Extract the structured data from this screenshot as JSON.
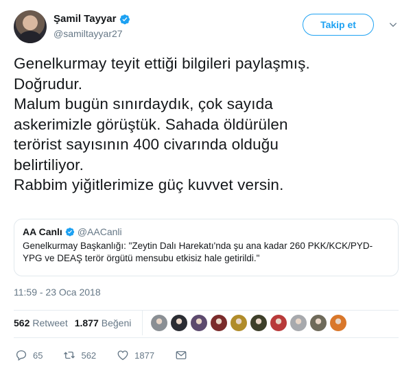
{
  "author": {
    "display_name": "Şamil Tayyar",
    "handle": "@samiltayyar27",
    "verified_color": "#1da1f2"
  },
  "header": {
    "follow_label": "Takip et",
    "menu_icon": "chevron-down-icon"
  },
  "tweet": {
    "text": "Genelkurmay teyit ettiği bilgileri paylaşmış.\nDoğrudur.\nMalum bugün sınırdaydık, çok sayıda\naskerimizle görüştük. Sahada öldürülen\nterörist sayısının 400 civarında olduğu\nbelirtiliyor.\nRabbim yiğitlerimize güç kuvvet versin.",
    "timestamp": "11:59 - 23 Oca 2018"
  },
  "quoted_tweet": {
    "display_name": "AA Canlı",
    "handle": "@AACanli",
    "text": "Genelkurmay Başkanlığı: \"Zeytin Dalı Harekatı'nda şu ana kadar 260 PKK/KCK/PYD-YPG ve DEAŞ terör örgütü mensubu etkisiz hale getirildi.\""
  },
  "stats": {
    "retweets_count": "562",
    "retweets_label": "Retweet",
    "likes_count": "1.877",
    "likes_label": "Beğeni",
    "liker_avatar_colors": [
      "#8a8f94",
      "#2a2d33",
      "#5c4a6e",
      "#7a2b2b",
      "#b08c2a",
      "#3d3f2a",
      "#b83a3a",
      "#a7a9ad",
      "#6e6a5a",
      "#d9772a"
    ]
  },
  "actions": {
    "reply_count": "65",
    "retweet_count": "562",
    "like_count": "1877"
  },
  "colors": {
    "accent": "#1da1f2",
    "secondary_text": "#657786",
    "border": "#e1e8ed"
  }
}
